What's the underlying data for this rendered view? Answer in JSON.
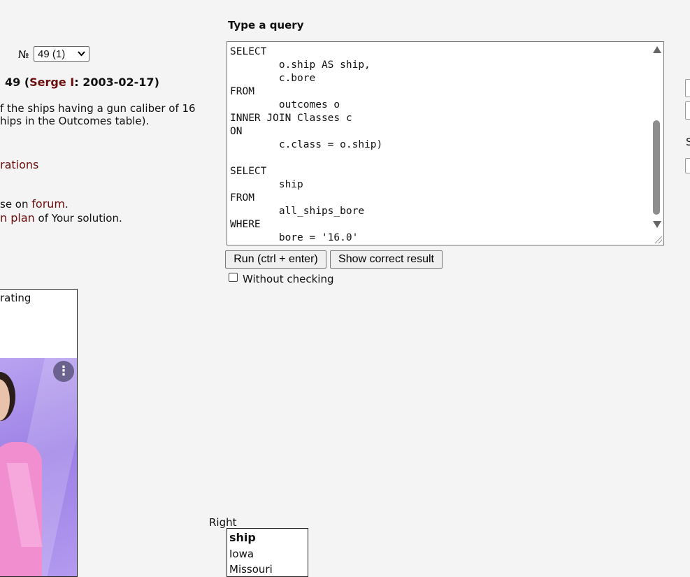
{
  "task_selector": {
    "label": "№",
    "selected": "49 (1)"
  },
  "task_title": {
    "number": "49 (",
    "author": "Serge I",
    "date": ": 2003-02-17)"
  },
  "description": {
    "line1": "f the ships having a gun caliber of 16",
    "line2": "hips in the Outcomes table)."
  },
  "links": {
    "rations": "rations",
    "forum_prefix": "se on ",
    "forum": "forum",
    "forum_suffix": ".",
    "plan": "n plan",
    "plan_suffix": " of Your solution."
  },
  "ad": {
    "label": "rating",
    "menu_glyph": "⋮"
  },
  "query": {
    "heading": "Type a query",
    "text": "SELECT\n        o.ship AS ship,\n        c.bore\nFROM\n        outcomes o\nINNER JOIN Classes c\nON\n        c.class = o.ship)\n\nSELECT\n        ship\nFROM\n        all_ships_bore\nWHERE\n        bore = '16.0'"
  },
  "buttons": {
    "run": "Run (ctrl + enter)",
    "show": "Show correct result"
  },
  "without_checking": {
    "label": "Without checking",
    "checked": false
  },
  "right_edge": {
    "s_label": "S"
  },
  "result": {
    "label": "Right",
    "columns": [
      "ship"
    ],
    "rows": [
      "Iowa",
      "Missouri"
    ]
  }
}
